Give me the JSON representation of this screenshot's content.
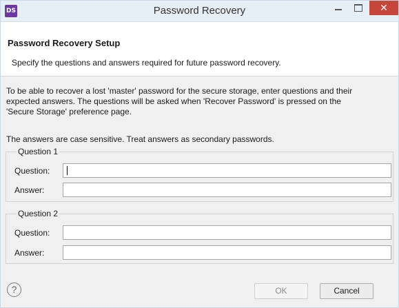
{
  "window": {
    "title": "Password Recovery",
    "app_badge": "DS",
    "minimize_icon": "minimize-icon",
    "maximize_icon": "maximize-icon",
    "close_glyph": "✕",
    "close_color": "#c7463b"
  },
  "header": {
    "title": "Password Recovery Setup",
    "description": "Specify the questions and answers required for future password recovery."
  },
  "body": {
    "intro_line1": "To be able to recover a lost 'master' password for the secure storage, enter questions and their",
    "intro_line2": "expected answers. The questions will be asked when 'Recover Password' is pressed on the",
    "intro_line3": "'Secure Storage' preference page.",
    "case_note": "The answers are case sensitive. Treat answers as secondary passwords."
  },
  "groups": [
    {
      "legend": "Question 1",
      "question_label": "Question:",
      "question_value": "",
      "answer_label": "Answer:",
      "answer_value": ""
    },
    {
      "legend": "Question 2",
      "question_label": "Question:",
      "question_value": "",
      "answer_label": "Answer:",
      "answer_value": ""
    }
  ],
  "footer": {
    "help_glyph": "?",
    "ok_label": "OK",
    "cancel_label": "Cancel"
  }
}
